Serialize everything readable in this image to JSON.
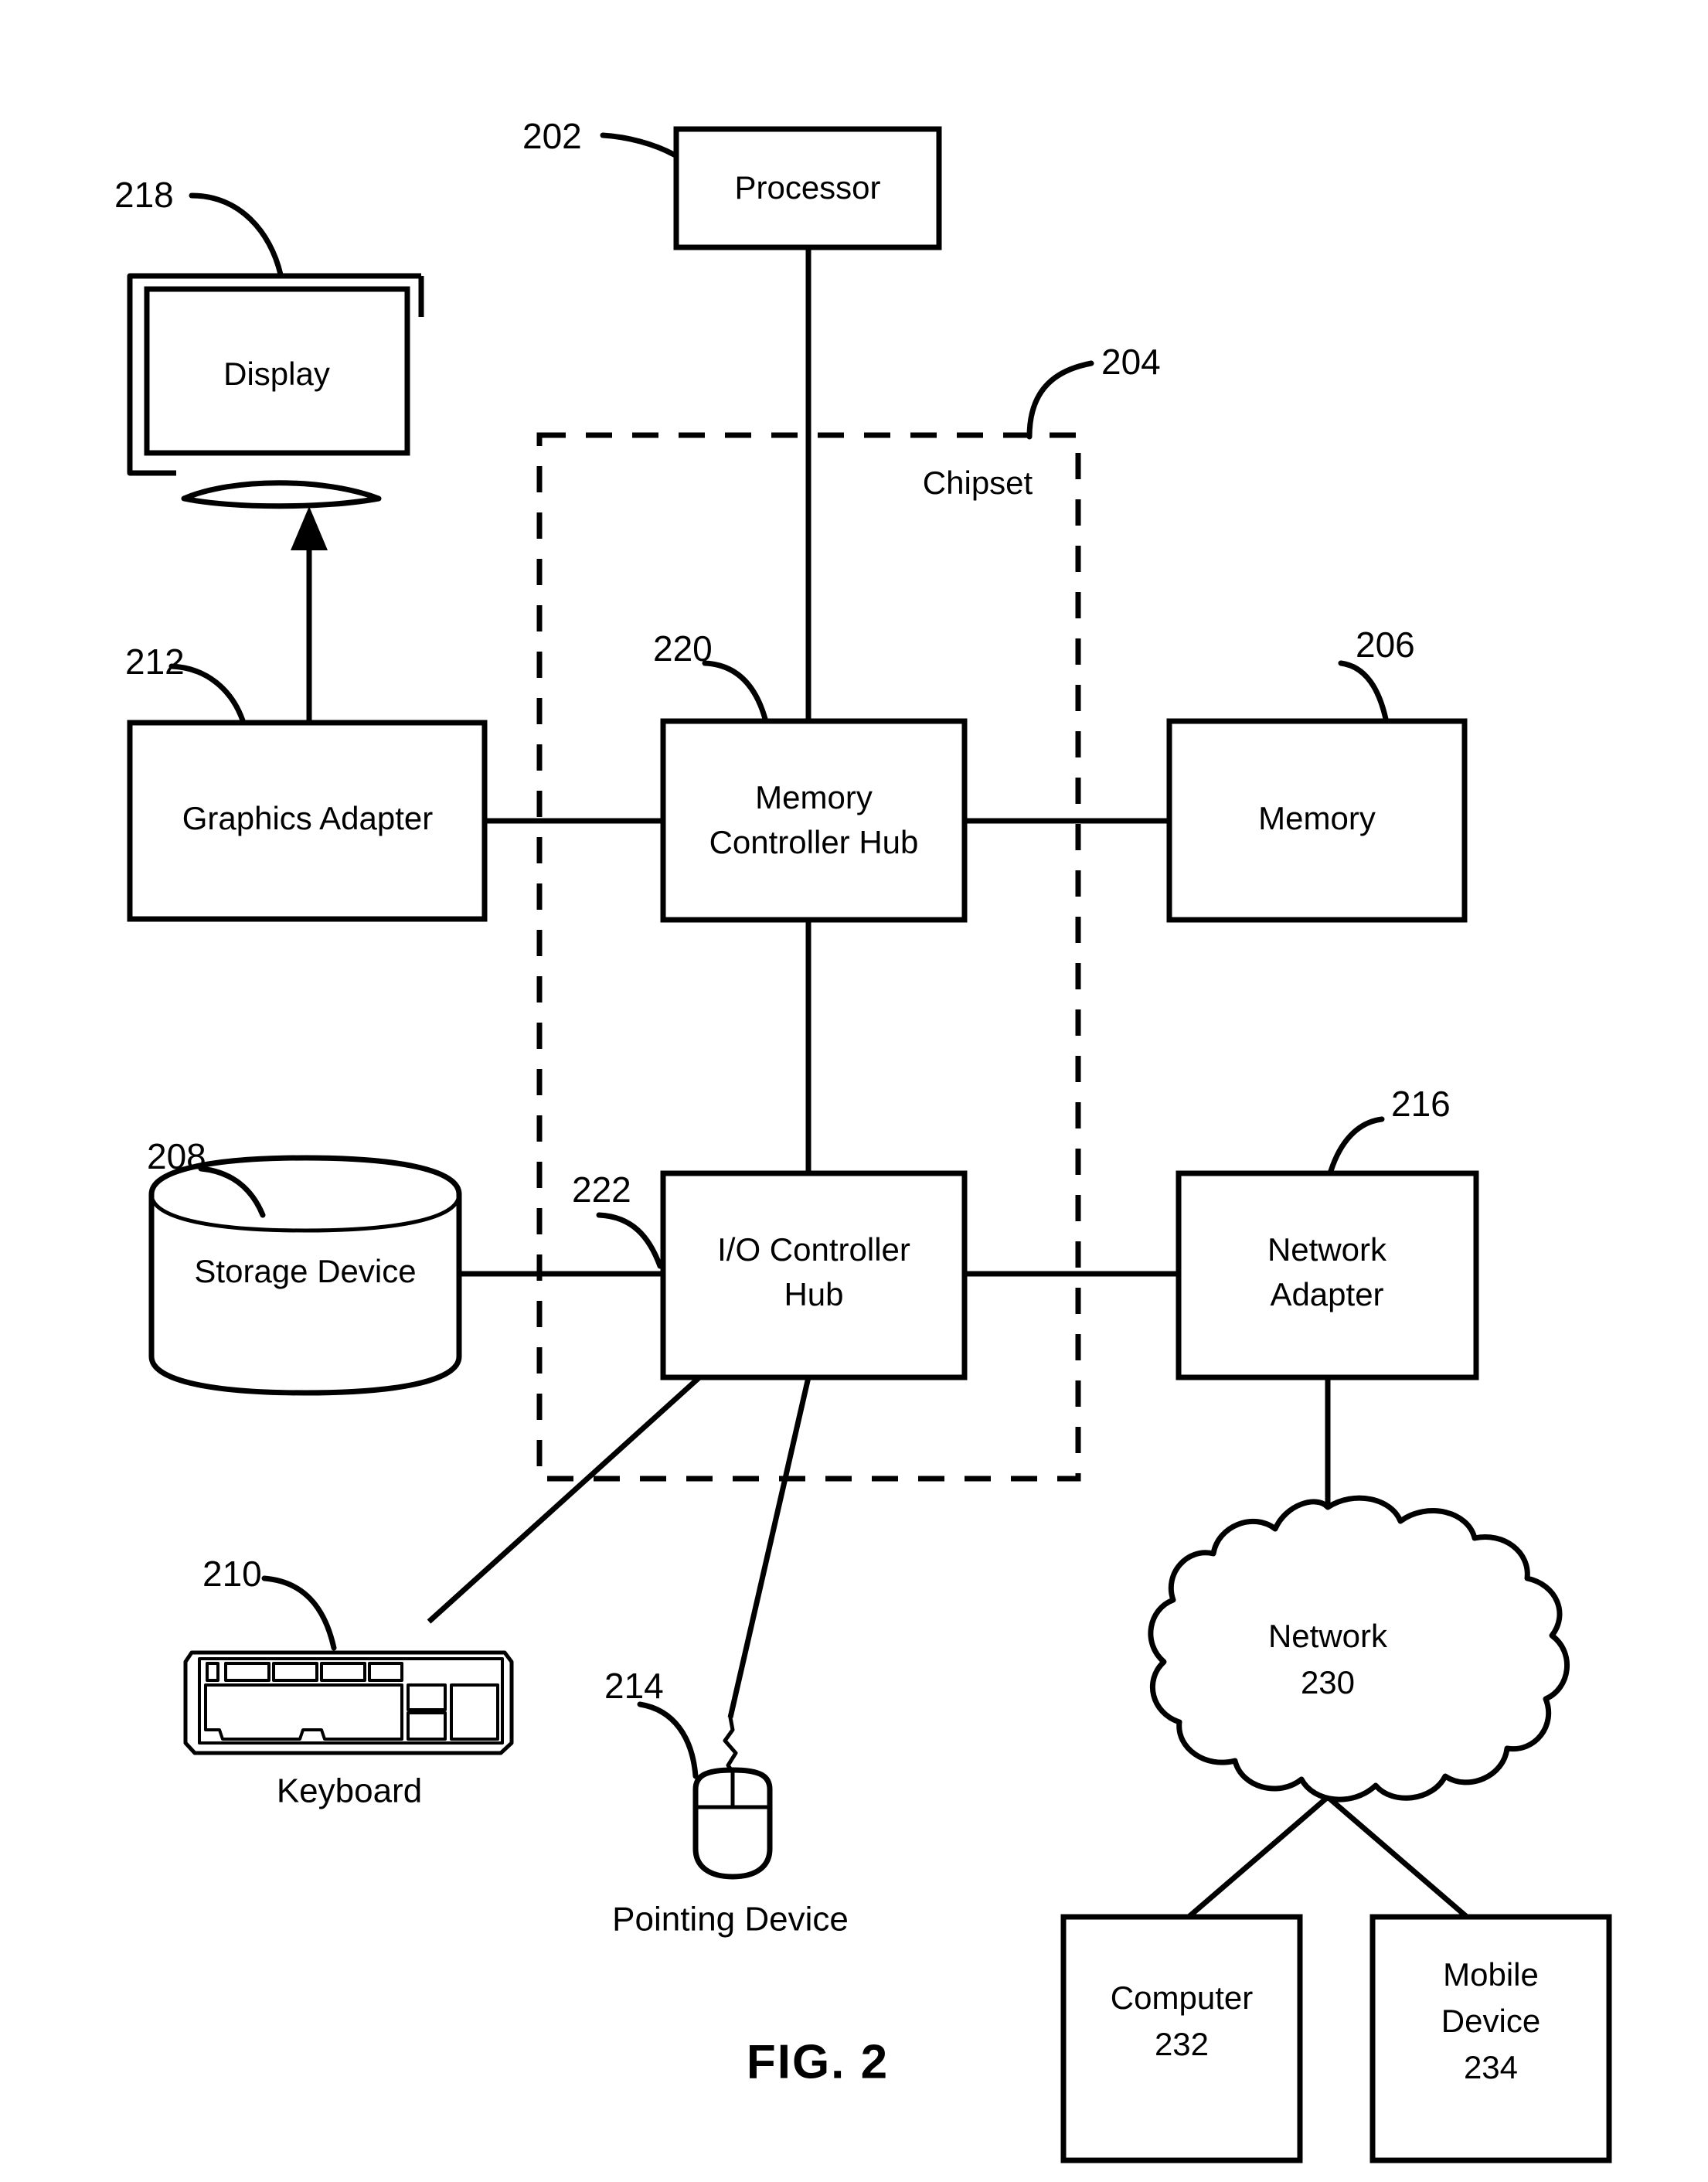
{
  "figure": {
    "caption": "FIG. 2",
    "chipset_label": "Chipset"
  },
  "blocks": {
    "processor": {
      "label": "Processor",
      "ref": "202"
    },
    "chipset": {
      "label": "Chipset",
      "ref": "204"
    },
    "memory": {
      "label": "Memory",
      "ref": "206"
    },
    "storage_device": {
      "label": "Storage Device",
      "ref": "208"
    },
    "keyboard": {
      "label": "Keyboard",
      "ref": "210"
    },
    "graphics_adapter": {
      "label": "Graphics Adapter",
      "ref": "212"
    },
    "pointing_device": {
      "label": "Pointing Device",
      "ref": "214"
    },
    "network_adapter": {
      "label_line1": "Network",
      "label_line2": "Adapter",
      "ref": "216"
    },
    "display": {
      "label": "Display",
      "ref": "218"
    },
    "memory_controller_hub": {
      "label_line1": "Memory",
      "label_line2": "Controller Hub",
      "ref": "220"
    },
    "io_controller_hub": {
      "label_line1": "I/O Controller",
      "label_line2": "Hub",
      "ref": "222"
    },
    "network": {
      "label_line1": "Network",
      "label_line2": "230",
      "ref": "230"
    },
    "computer": {
      "label_line1": "Computer",
      "label_line2": "232",
      "ref": "232"
    },
    "mobile_device": {
      "label_line1": "Mobile",
      "label_line2": "Device",
      "label_line3": "234",
      "ref": "234"
    }
  },
  "colors": {
    "ink": "#000000",
    "paper": "#ffffff"
  }
}
